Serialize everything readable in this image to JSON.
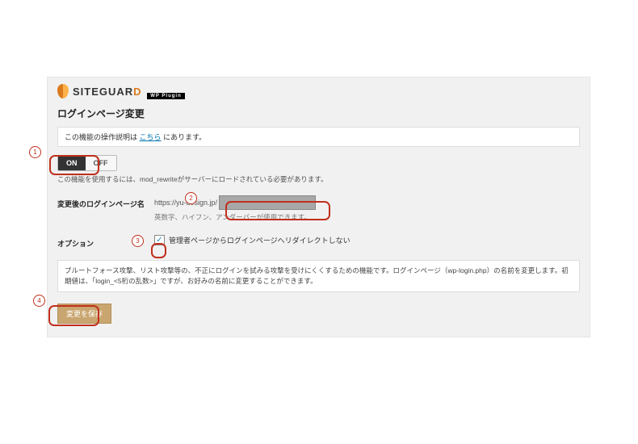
{
  "logo": {
    "brand_main": "SITEGUAR",
    "brand_accent": "D",
    "sub": "WP Plugin"
  },
  "page_title": "ログインページ変更",
  "notice": {
    "prefix": "この機能の操作説明は",
    "link": "こちら",
    "suffix": "にあります。"
  },
  "toggle": {
    "on": "ON",
    "off": "OFF"
  },
  "mod_rewrite_note": "この機能を使用するには、mod_rewriteがサーバーにロードされている必要があります。",
  "login_page": {
    "label": "変更後のログインページ名",
    "url_prefix": "https://yu-design.jp/",
    "value": "",
    "hint": "英数字、ハイフン、アンダーバーが使用できます。"
  },
  "option": {
    "label": "オプション",
    "checkbox_checked": true,
    "checkbox_label": "管理者ページからログインページへリダイレクトしない"
  },
  "description": "ブルートフォース攻撃、リスト攻撃等の、不正にログインを試みる攻撃を受けにくくするための機能です。ログインページ（wp-login.php）の名前を変更します。初期値は、「login_<5桁の乱数>」ですが、お好みの名前に変更することができます。",
  "save_button": "変更を保存",
  "annotations": {
    "n1": "1",
    "n2": "2",
    "n3": "3",
    "n4": "4"
  }
}
